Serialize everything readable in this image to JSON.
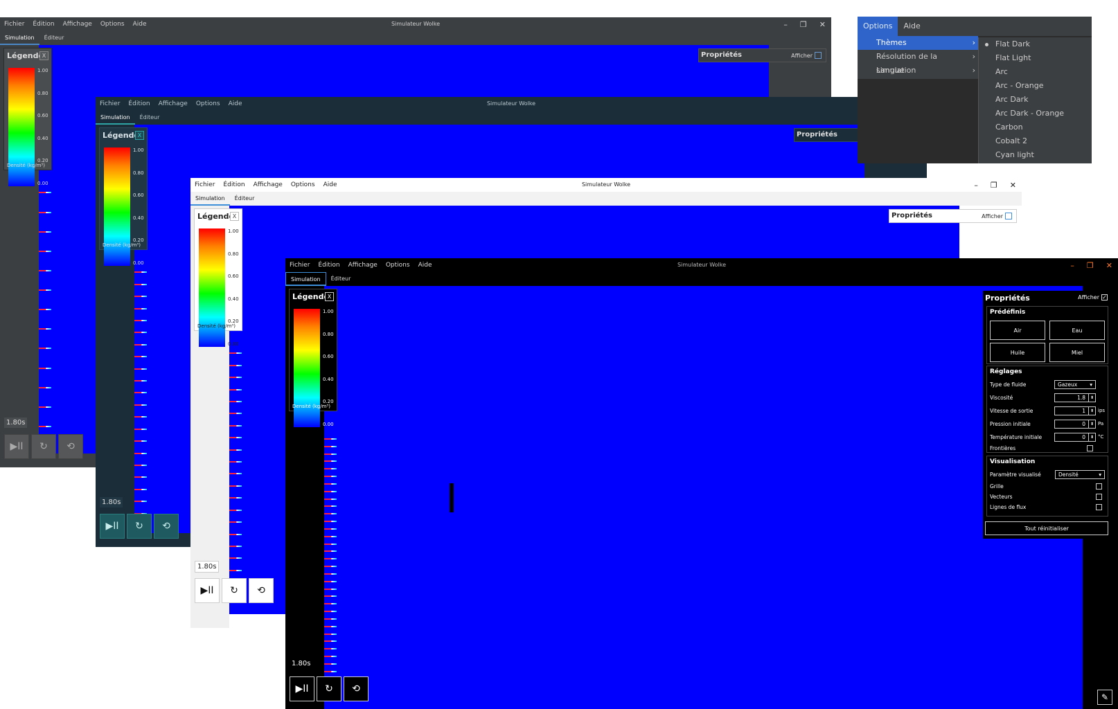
{
  "app": {
    "title": "Simulateur Wolke",
    "menu": [
      "Fichier",
      "Édition",
      "Affichage",
      "Options",
      "Aide"
    ],
    "tabs": [
      "Simulation",
      "Éditeur"
    ],
    "window_controls": {
      "minimize": "–",
      "restore": "❐",
      "close": "✕"
    }
  },
  "legend": {
    "title": "Légende",
    "close": "X",
    "ticks": [
      "1.00",
      "0.80",
      "0.60",
      "0.40",
      "0.20",
      "0.00"
    ],
    "footer": "Densité (kg/m³)"
  },
  "controls": {
    "time": "1.80s",
    "play_pause_icon": "play-pause-icon",
    "step_icon": "step-forward-icon",
    "reset_icon": "reset-icon",
    "play_glyph": "▶II",
    "step_glyph": "↻",
    "reset_glyph": "⟲"
  },
  "properties": {
    "title": "Propriétés",
    "show_label": "Afficher",
    "show_checked_last": true,
    "presets": {
      "title": "Prédéfinis",
      "buttons": [
        "Air",
        "Eau",
        "Huile",
        "Miel"
      ]
    },
    "settings": {
      "title": "Réglages",
      "fluid_type": {
        "label": "Type de fluide",
        "value": "Gazeux"
      },
      "viscosity": {
        "label": "Viscosité",
        "value": "1.8"
      },
      "outlet_speed": {
        "label": "Vitesse de sortie",
        "value": "1",
        "unit": "ips"
      },
      "initial_pressure": {
        "label": "Pression initiale",
        "value": "0",
        "unit": "Pa"
      },
      "initial_temperature": {
        "label": "Température initiale",
        "value": "0",
        "unit": "°C"
      },
      "borders": {
        "label": "Frontières"
      }
    },
    "visualisation": {
      "title": "Visualisation",
      "parameter": {
        "label": "Paramètre visualisé",
        "value": "Densité"
      },
      "grid": "Grille",
      "vectors": "Vecteurs",
      "flow_lines": "Lignes de flux"
    },
    "reset_all": "Tout réinitialiser"
  },
  "options_menu": {
    "bar": [
      "Options",
      "Aide"
    ],
    "items": [
      "Thèmes",
      "Résolution de la simulation",
      "Langue"
    ],
    "themes": [
      "Flat Dark",
      "Flat Light",
      "Arc",
      "Arc - Orange",
      "Arc Dark",
      "Arc Dark - Orange",
      "Carbon",
      "Cobalt 2",
      "Cyan light"
    ],
    "selected_theme": "Flat Dark"
  },
  "colors": {
    "sim_background": "#0000ff",
    "flat_dark_bg": "#3c3f41",
    "cobalt_bg": "#1b2d38",
    "menu_highlight": "#2f65ca",
    "accent_orange": "#ff7a2a"
  }
}
